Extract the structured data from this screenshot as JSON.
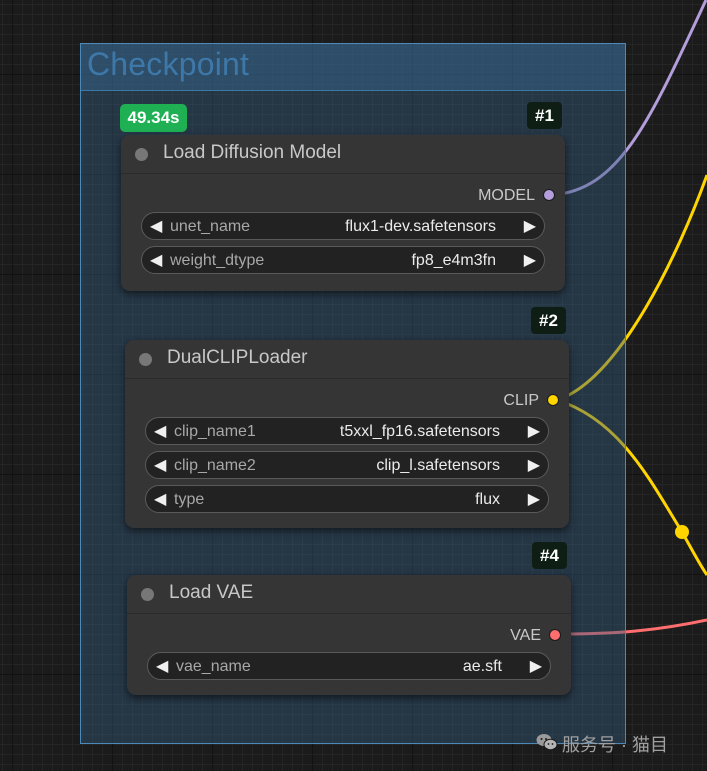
{
  "group": {
    "title": "Checkpoint"
  },
  "execution_time": "49.34s",
  "nodes": [
    {
      "id": "#1",
      "title": "Load Diffusion Model",
      "output": {
        "label": "MODEL",
        "color": "#b39ddb"
      },
      "widgets": [
        {
          "name": "unet_name",
          "value": "flux1-dev.safetensors"
        },
        {
          "name": "weight_dtype",
          "value": "fp8_e4m3fn"
        }
      ]
    },
    {
      "id": "#2",
      "title": "DualCLIPLoader",
      "output": {
        "label": "CLIP",
        "color": "#ffd500"
      },
      "widgets": [
        {
          "name": "clip_name1",
          "value": "t5xxl_fp16.safetensors"
        },
        {
          "name": "clip_name2",
          "value": "clip_l.safetensors"
        },
        {
          "name": "type",
          "value": "flux"
        }
      ]
    },
    {
      "id": "#4",
      "title": "Load VAE",
      "output": {
        "label": "VAE",
        "color": "#ff6e6e"
      },
      "widgets": [
        {
          "name": "vae_name",
          "value": "ae.sft"
        }
      ]
    }
  ],
  "arrows": {
    "left": "◀",
    "right": "▶"
  },
  "watermark": {
    "text": "服务号 · 猫目",
    "icon": "wechat-icon"
  }
}
